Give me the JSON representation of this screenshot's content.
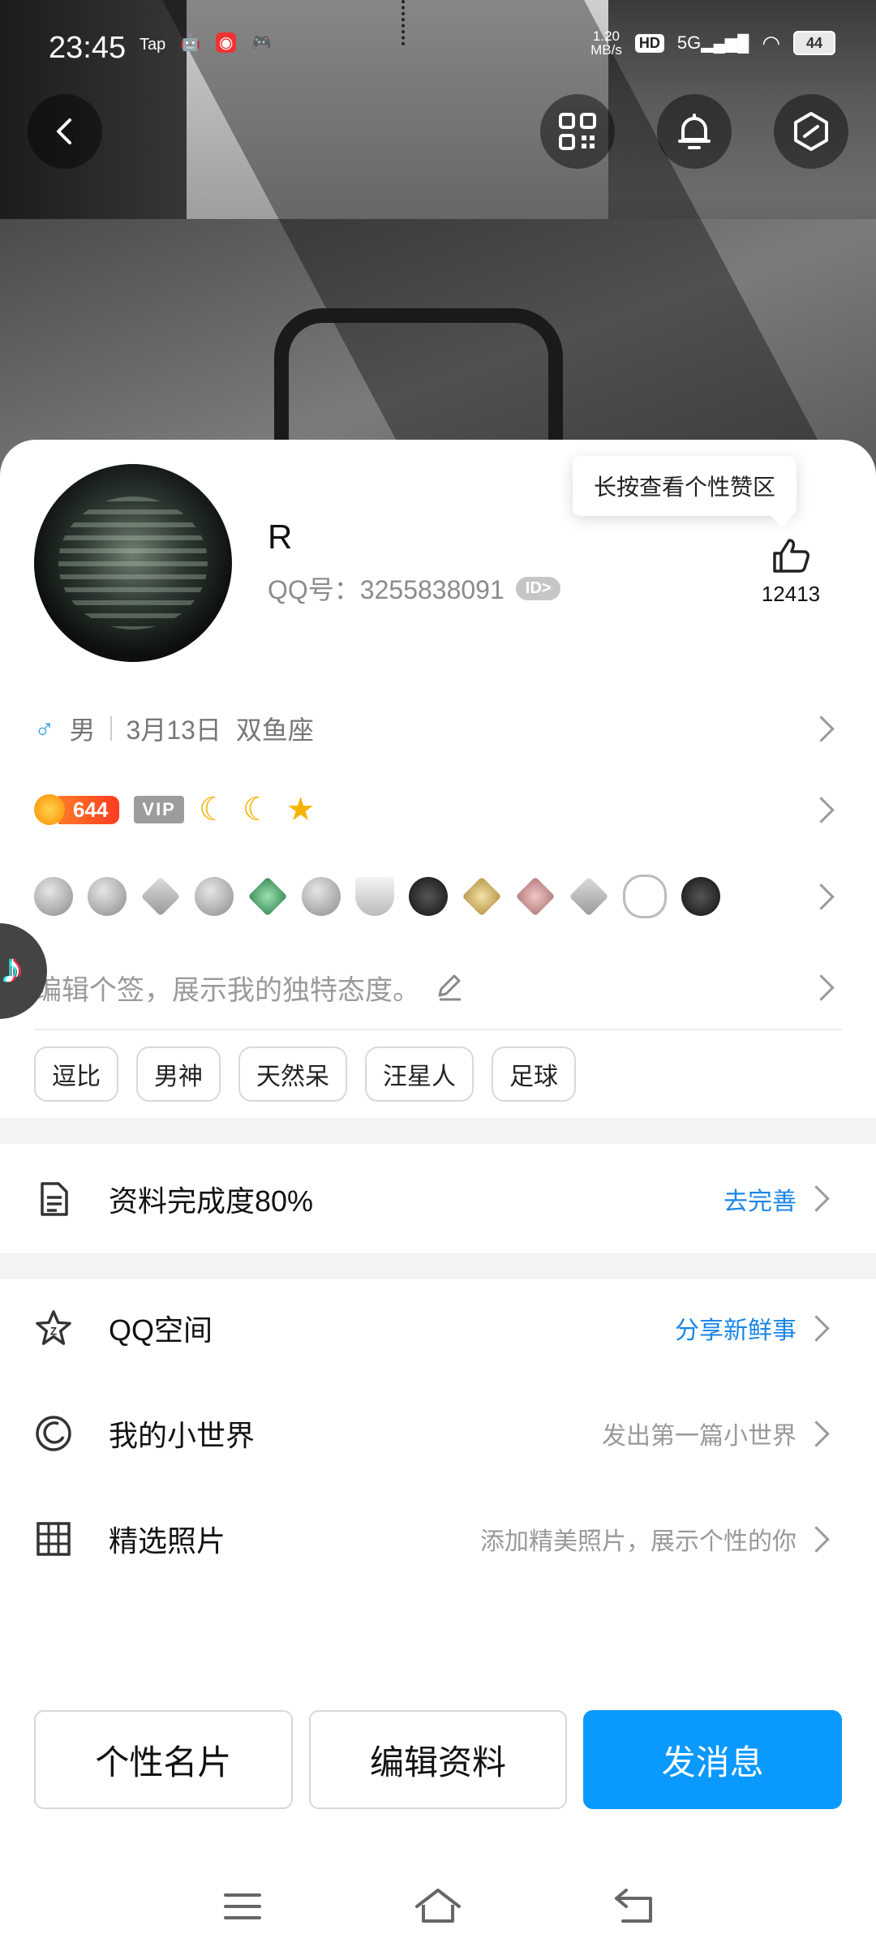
{
  "status_bar": {
    "time": "23:45",
    "app_small": "Tap",
    "net_speed": "1.20\nMB/s",
    "hd": "HD",
    "network": "5G",
    "battery": "44"
  },
  "header": {
    "back_icon": "chevron-left-icon",
    "qr_icon": "qr-code-icon",
    "bell_icon": "bell-icon",
    "settings_icon": "hexagon-settings-icon"
  },
  "profile": {
    "name": "R",
    "qq_label": "QQ号：",
    "qq_number": "3255838091",
    "id_badge": "ID>",
    "tooltip": "长按查看个性赞区",
    "like_count": "12413",
    "gender_symbol": "♂",
    "gender": "男",
    "birthday": "3月13日",
    "zodiac": "双鱼座",
    "level": "644",
    "vip": "VIP",
    "signature_placeholder": "编辑个签，展示我的独特态度。",
    "tags": [
      "逗比",
      "男神",
      "天然呆",
      "汪星人",
      "足球"
    ]
  },
  "completion": {
    "title": "资料完成度80%",
    "action": "去完善"
  },
  "list": [
    {
      "title": "QQ空间",
      "right": "分享新鲜事",
      "icon": "star-icon"
    },
    {
      "title": "我的小世界",
      "right": "发出第一篇小世界",
      "icon": "circle-world-icon"
    },
    {
      "title": "精选照片",
      "right": "添加精美照片，展示个性的你",
      "icon": "grid-photo-icon"
    }
  ],
  "buttons": {
    "card": "个性名片",
    "edit": "编辑资料",
    "message": "发消息"
  },
  "colors": {
    "primary": "#0a99ff",
    "link_blue": "#1a86e6",
    "male_blue": "#2aa2e8",
    "level_orange": "#ff5a1f"
  }
}
